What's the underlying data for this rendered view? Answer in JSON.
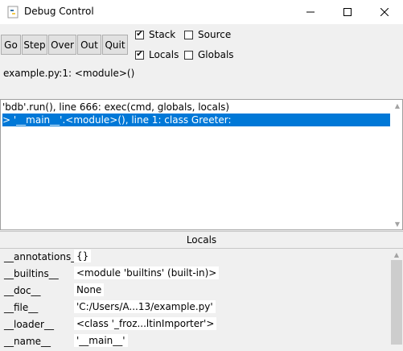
{
  "window": {
    "title": "Debug Control"
  },
  "toolbar": {
    "buttons": [
      "Go",
      "Step",
      "Over",
      "Out",
      "Quit"
    ]
  },
  "options": {
    "stack": {
      "label": "Stack",
      "checked": true
    },
    "source": {
      "label": "Source",
      "checked": false
    },
    "locals": {
      "label": "Locals",
      "checked": true
    },
    "globals": {
      "label": "Globals",
      "checked": false
    }
  },
  "status": "example.py:1: <module>()",
  "stack_items": [
    "'bdb'.run(), line 666: exec(cmd, globals, locals)",
    "> '__main__'.<module>(), line 1: class Greeter:"
  ],
  "locals_header": "Locals",
  "locals": [
    {
      "name": "__annotations__",
      "value": "{}"
    },
    {
      "name": "__builtins__",
      "value": "<module 'builtins' (built-in)>"
    },
    {
      "name": "__doc__",
      "value": "None"
    },
    {
      "name": "__file__",
      "value": "'C:/Users/A...13/example.py'"
    },
    {
      "name": "__loader__",
      "value": "<class '_froz...ltinImporter'>"
    },
    {
      "name": "__name__",
      "value": "'__main__'"
    }
  ],
  "colors": {
    "selection": "#0078d7"
  }
}
